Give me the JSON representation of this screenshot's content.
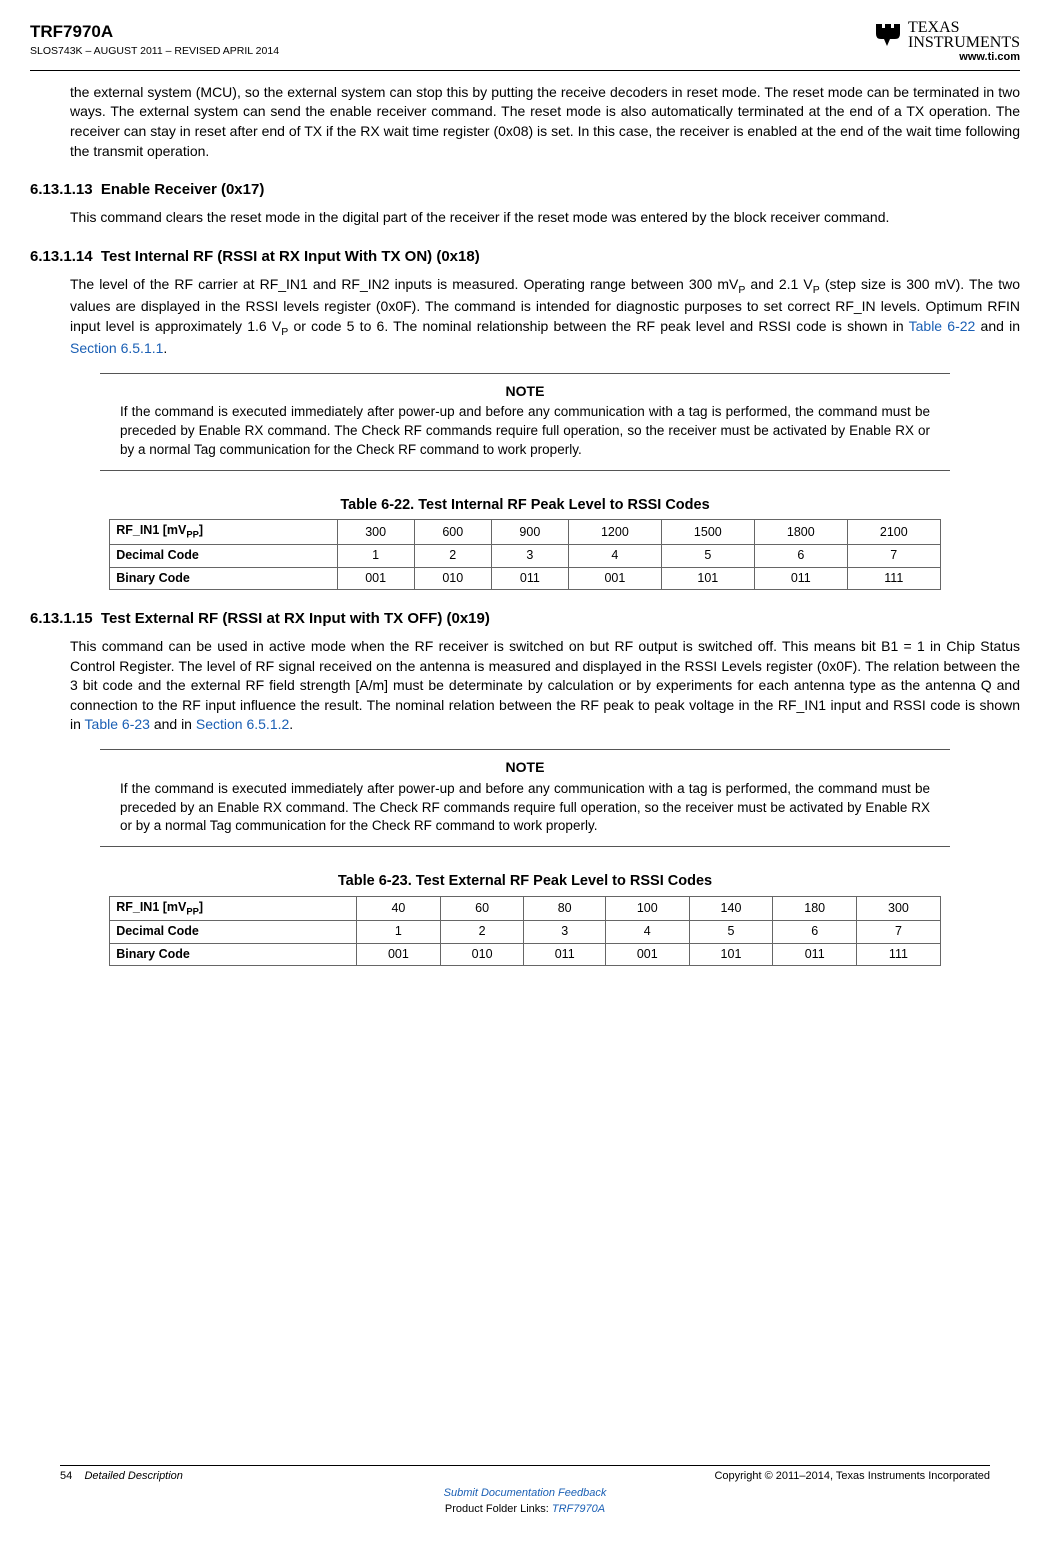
{
  "header": {
    "product": "TRF7970A",
    "docnum": "SLOS743K – AUGUST 2011 – REVISED APRIL 2014",
    "url": "www.ti.com",
    "logo_text1": "TEXAS",
    "logo_text2": "INSTRUMENTS"
  },
  "para_intro": "the external system (MCU), so the external system can stop this by putting the receive decoders in reset mode. The reset mode can be terminated in two ways. The external system can send the enable receiver command. The reset mode is also automatically terminated at the end of a TX operation. The receiver can stay in reset after end of TX if the RX wait time register (0x08) is set. In this case, the receiver is enabled at the end of the wait time following the transmit operation.",
  "sec13": {
    "num": "6.13.1.13",
    "title": "Enable Receiver (0x17)",
    "body": "This command clears the reset mode in the digital part of the receiver if the reset mode was entered by the block receiver command."
  },
  "sec14": {
    "num": "6.13.1.14",
    "title": "Test Internal RF (RSSI at RX Input With TX ON) (0x18)",
    "body_a": "The level of the RF carrier at RF_IN1 and RF_IN2 inputs is measured. Operating range between 300 mV",
    "body_b": " and 2.1 V",
    "body_c": " (step size is 300 mV). The two values are displayed in the RSSI levels register (0x0F). The command is intended for diagnostic purposes to set correct RF_IN levels. Optimum RFIN input level is approximately 1.6 V",
    "body_d": " or code 5 to 6. The nominal relationship between the RF peak level and RSSI code is shown in ",
    "xref1": "Table 6-22",
    "body_e": " and in ",
    "xref2": "Section 6.5.1.1",
    "body_f": "."
  },
  "note1": {
    "title": "NOTE",
    "body": "If the command is executed immediately after power-up and before any communication with a tag is performed, the command must be preceded by Enable RX command. The Check RF commands require full operation, so the receiver must be activated by Enable RX or by a normal Tag communication for the Check RF command to work properly."
  },
  "table22": {
    "title": "Table 6-22. Test Internal RF Peak Level to RSSI Codes",
    "row1_label": "RF_IN1 [mV",
    "row1_sub": "PP",
    "row1_close": "]",
    "r1": [
      "300",
      "600",
      "900",
      "1200",
      "1500",
      "1800",
      "2100"
    ],
    "row2_label": "Decimal Code",
    "r2": [
      "1",
      "2",
      "3",
      "4",
      "5",
      "6",
      "7"
    ],
    "row3_label": "Binary Code",
    "r3": [
      "001",
      "010",
      "011",
      "001",
      "101",
      "011",
      "111"
    ]
  },
  "sec15": {
    "num": "6.13.1.15",
    "title": "Test External RF (RSSI at RX Input with TX OFF) (0x19)",
    "body_a": "This command can be used in active mode when the RF receiver is switched on but RF output is switched off. This means bit B1 = 1 in Chip Status Control Register. The level of RF signal received on the antenna is measured and displayed in the RSSI Levels register (0x0F). The relation between the 3 bit code and the external RF field strength [A/m] must be determinate by calculation or by experiments for each antenna type as the antenna Q and connection to the RF input influence the result. The nominal relation between the RF peak to peak voltage in the RF_IN1 input and RSSI code is shown in ",
    "xref1": "Table 6-23",
    "body_b": " and in ",
    "xref2": "Section 6.5.1.2",
    "body_c": "."
  },
  "note2": {
    "title": "NOTE",
    "body": "If the command is executed immediately after power-up and before any communication with a tag is performed, the command must be preceded by an Enable RX command. The Check RF commands require full operation, so the receiver must be activated by Enable RX or by a normal Tag communication for the Check RF command to work properly."
  },
  "table23": {
    "title": "Table 6-23. Test External RF Peak Level to RSSI Codes",
    "row1_label": "RF_IN1 [mV",
    "row1_sub": "PP",
    "row1_close": "]",
    "r1": [
      "40",
      "60",
      "80",
      "100",
      "140",
      "180",
      "300"
    ],
    "row2_label": "Decimal Code",
    "r2": [
      "1",
      "2",
      "3",
      "4",
      "5",
      "6",
      "7"
    ],
    "row3_label": "Binary Code",
    "r3": [
      "001",
      "010",
      "011",
      "001",
      "101",
      "011",
      "111"
    ]
  },
  "footer": {
    "page": "54",
    "section": "Detailed Description",
    "copyright": "Copyright © 2011–2014, Texas Instruments Incorporated",
    "submit": "Submit Documentation Feedback",
    "folder_pre": "Product Folder Links: ",
    "folder_link": "TRF7970A"
  }
}
